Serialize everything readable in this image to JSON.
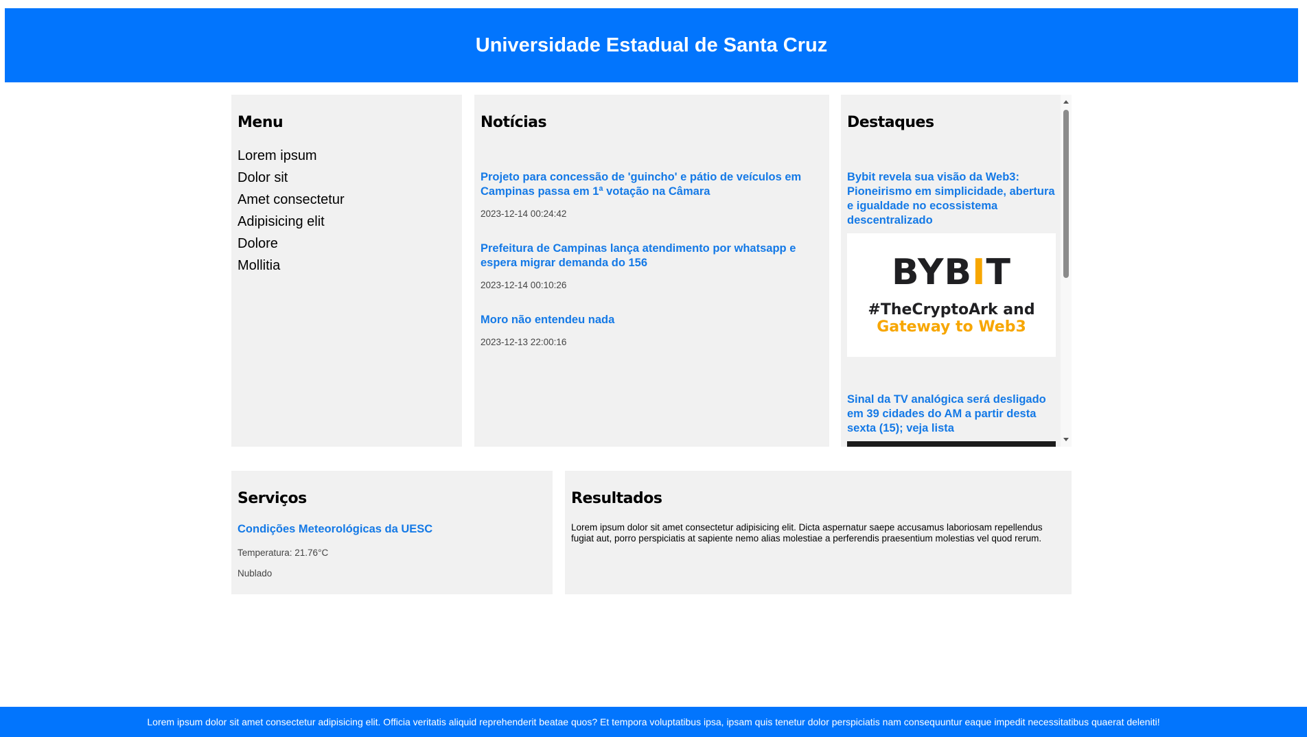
{
  "header": {
    "title": "Universidade Estadual de Santa Cruz"
  },
  "menu": {
    "title": "Menu",
    "items": [
      {
        "label": "Lorem ipsum"
      },
      {
        "label": "Dolor sit"
      },
      {
        "label": "Amet consectetur"
      },
      {
        "label": "Adipisicing elit"
      },
      {
        "label": "Dolore"
      },
      {
        "label": "Mollitia"
      }
    ]
  },
  "news": {
    "title": "Notícias",
    "items": [
      {
        "title": "Projeto para concessão de 'guincho' e pátio de veículos em Campinas passa em 1ª votação na Câmara",
        "date": "2023-12-14 00:24:42"
      },
      {
        "title": "Prefeitura de Campinas lança atendimento por whatsapp e espera migrar demanda do 156",
        "date": "2023-12-14 00:10:26"
      },
      {
        "title": "Moro não entendeu nada",
        "date": "2023-12-13 22:00:16"
      }
    ]
  },
  "highlights": {
    "title": "Destaques",
    "items": [
      {
        "title": "Bybit revela sua visão da Web3: Pioneirismo em simplicidade, abertura e igualdade no ecossistema descentralizado",
        "image": {
          "logo_left": "BYB",
          "logo_bar": "I",
          "logo_right": "T",
          "line1": "#TheCryptoArk and",
          "line2": "Gateway to Web3"
        }
      },
      {
        "title": "Sinal da TV analógica será desligado em 39 cidades do AM a partir desta sexta (15); veja lista"
      }
    ]
  },
  "services": {
    "title": "Serviços",
    "link": "Condições Meteorológicas da UESC",
    "temperature": "Temperatura: 21.76°C",
    "condition": "Nublado"
  },
  "results": {
    "title": "Resultados",
    "text": "Lorem ipsum dolor sit amet consectetur adipisicing elit. Dicta aspernatur saepe accusamus laboriosam repellendus fugiat aut, porro perspiciatis at sapiente nemo alias molestiae a perferendis praesentium molestias vel quod rerum."
  },
  "footer": {
    "text": "Lorem ipsum dolor sit amet consectetur adipisicing elit. Officia veritatis aliquid reprehenderit beatae quos? Et tempora voluptatibus ipsa, ipsam quis tenetur dolor perspiciatis nam consequuntur eaque impedit necessitatibus quaerat deleniti!"
  },
  "colors": {
    "brand": "#0275fd",
    "link": "#1479e6",
    "panel": "#f1f1f1",
    "bybit_accent": "#f7a600"
  }
}
